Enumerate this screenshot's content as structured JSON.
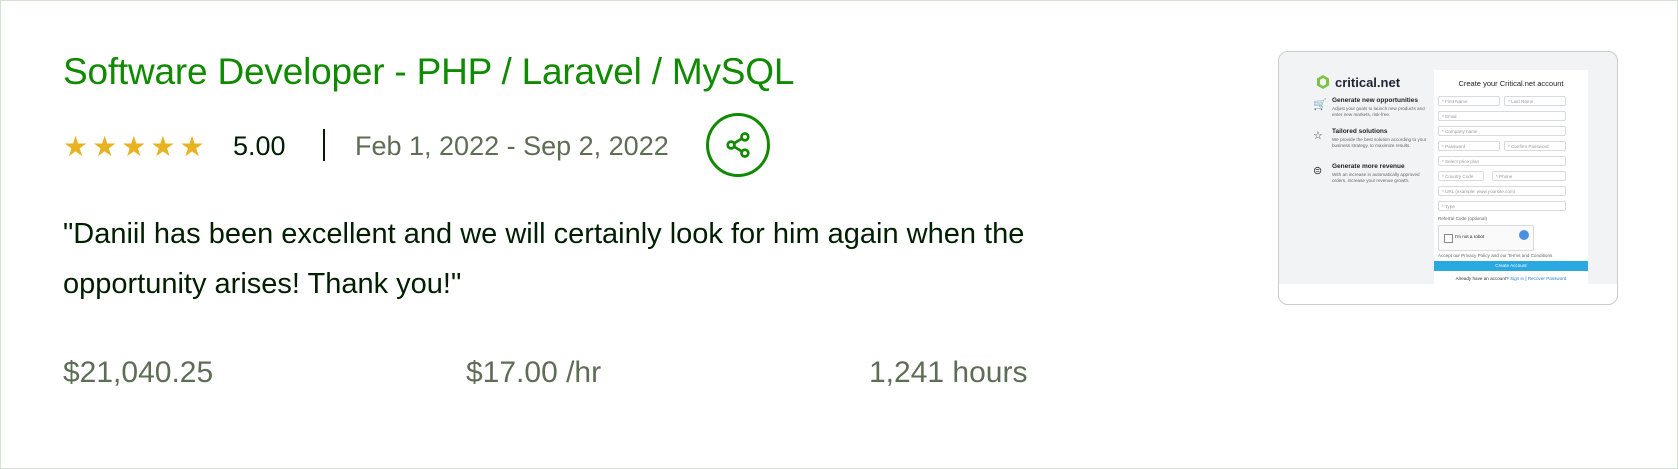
{
  "job": {
    "title": "Software Developer - PHP / Laravel / MySQL",
    "rating": "5.00",
    "stars": 5,
    "dates": "Feb 1, 2022 - Sep 2, 2022",
    "feedback": "\"Daniil has been excellent and we will certainly look for him again when the opportunity arises! Thank you!\"",
    "total_earned": "$21,040.25",
    "hourly_rate": "$17.00 /hr",
    "hours": "1,241 hours"
  },
  "colors": {
    "brand_green": "#108a00",
    "star": "#e8b321",
    "muted": "#5e6d55"
  },
  "icons": {
    "share": "share-icon",
    "star": "star-icon"
  },
  "thumbnail": {
    "logo_text": "critical.net",
    "form_title": "Create your Critical.net account",
    "features": [
      {
        "heading": "Generate new opportunities",
        "desc": "Adjust your goals to launch new products and enter new markets, risk-free."
      },
      {
        "heading": "Tailored solutions",
        "desc": "We provide the best solution according to your business strategy, to maximize results."
      },
      {
        "heading": "Generate more revenue",
        "desc": "With an increase in automatically approved orders, increase your revenue growth."
      }
    ],
    "fields": {
      "first_name": "* First Name",
      "last_name": "* Last Name",
      "email": "* Email",
      "company": "* Company name",
      "password": "* Password",
      "confirm_password": "* Confirm Password",
      "price_plan": "* Select price plan",
      "country_code": "* Country Code",
      "phone": "* Phone",
      "url": "* URL (example: www.yoursite.com)",
      "type": "* Type"
    },
    "referral_label": "Referral Code (optional)",
    "captcha_text": "I'm not a robot",
    "accept_text": "Accept our Privacy Policy and our Terms and Conditions",
    "create_button": "Create Account",
    "signin_text": "Already have an account?",
    "signin_link": "Sign in",
    "recover_link": "Recover Password"
  }
}
